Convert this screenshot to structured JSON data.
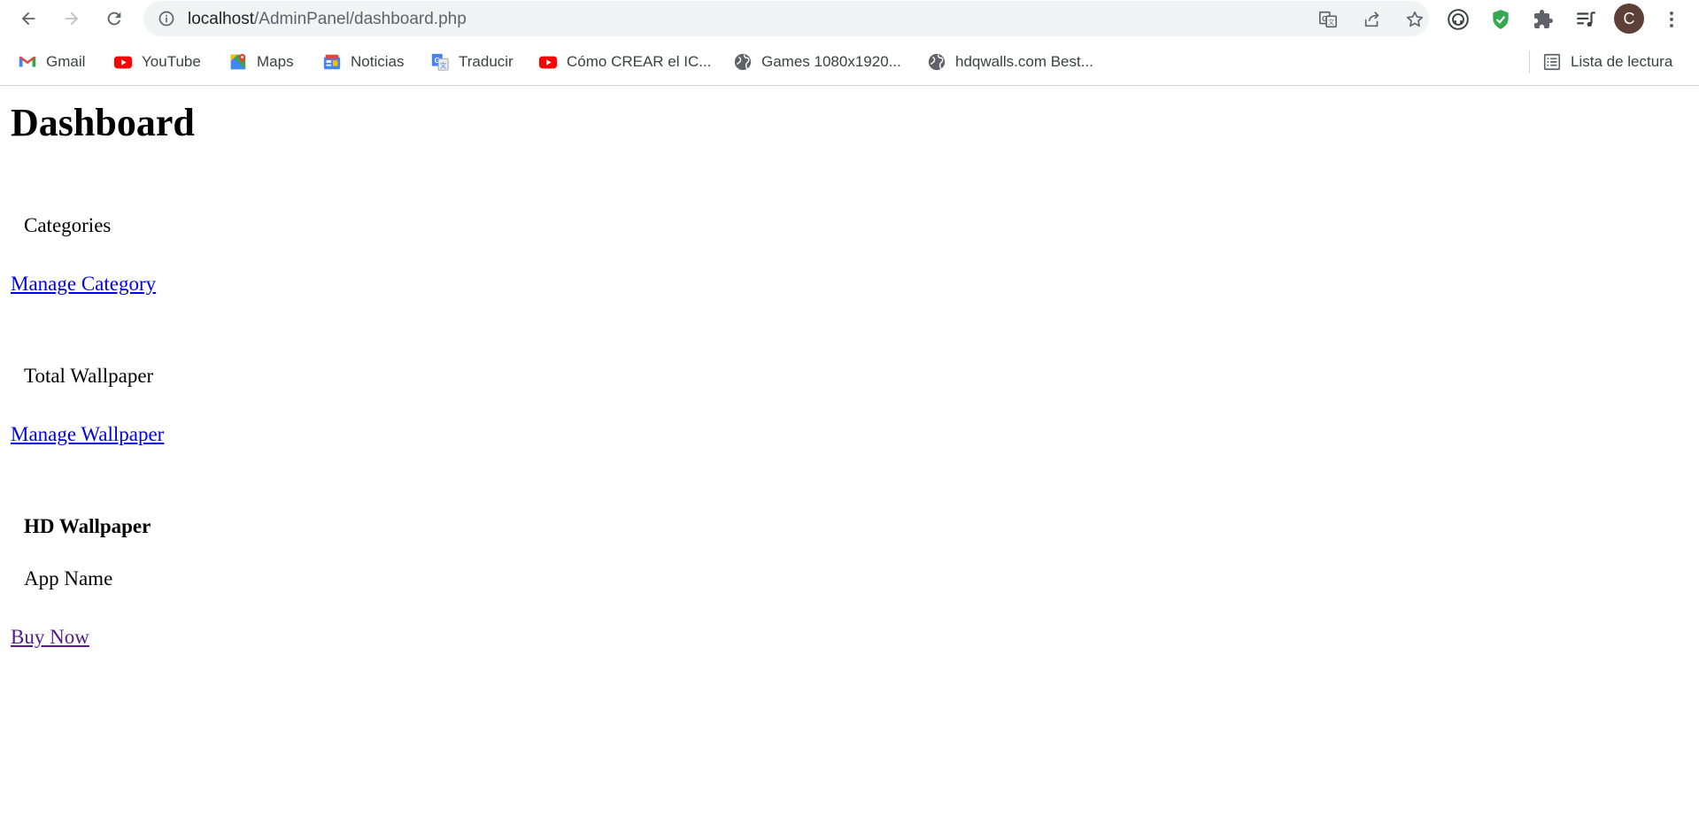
{
  "browser": {
    "url_host": "localhost",
    "url_path": "/AdminPanel/dashboard.php",
    "avatar_letter": "C",
    "bookmarks": [
      {
        "label": "Gmail",
        "icon": "gmail-icon"
      },
      {
        "label": "YouTube",
        "icon": "youtube-icon"
      },
      {
        "label": "Maps",
        "icon": "maps-icon"
      },
      {
        "label": "Noticias",
        "icon": "news-icon"
      },
      {
        "label": "Traducir",
        "icon": "translate-icon"
      },
      {
        "label": "Cómo CREAR el IC...",
        "icon": "youtube-icon"
      },
      {
        "label": "Games 1080x1920...",
        "icon": "globe-icon"
      },
      {
        "label": "hdqwalls.com Best...",
        "icon": "globe-icon"
      }
    ],
    "reading_list_label": "Lista de lectura"
  },
  "page": {
    "title": "Dashboard",
    "sections": [
      {
        "label": "Categories",
        "link": "Manage Category"
      },
      {
        "label": "Total Wallpaper",
        "link": "Manage Wallpaper"
      }
    ],
    "product": {
      "heading": "HD Wallpaper",
      "app_name": "App Name",
      "buy_link": "Buy Now"
    }
  },
  "colors": {
    "link": "#0000ee",
    "visited_link": "#551a8b",
    "avatar_bg": "#5d4037",
    "shield_green": "#34a853"
  }
}
